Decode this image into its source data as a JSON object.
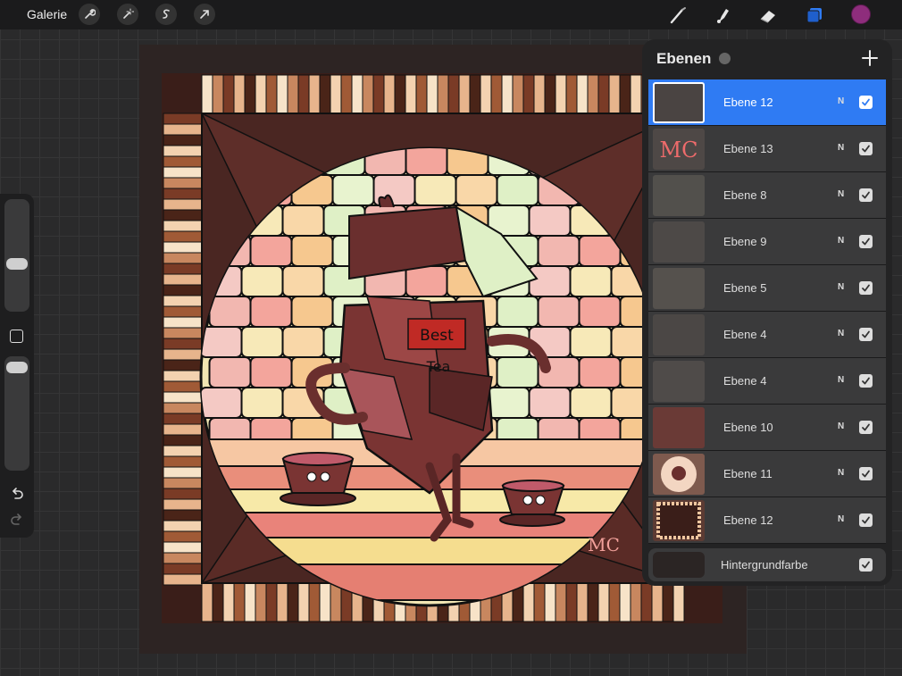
{
  "topbar": {
    "gallery_label": "Galerie",
    "left_tools": [
      "wrench-icon",
      "magic-wand-icon",
      "selection-icon",
      "transform-arrow-icon"
    ],
    "right_tools": [
      "brush-icon",
      "smudge-icon",
      "eraser-icon",
      "layers-icon"
    ],
    "current_color": "#8e2d7c"
  },
  "layers_panel": {
    "title": "Ebenen",
    "add_label": "+",
    "layers": [
      {
        "name": "Ebene 12",
        "mode": "N",
        "visible": true,
        "active": true
      },
      {
        "name": "Ebene 13",
        "mode": "N",
        "visible": true,
        "active": false
      },
      {
        "name": "Ebene 8",
        "mode": "N",
        "visible": true,
        "active": false
      },
      {
        "name": "Ebene 9",
        "mode": "N",
        "visible": true,
        "active": false
      },
      {
        "name": "Ebene 5",
        "mode": "N",
        "visible": true,
        "active": false
      },
      {
        "name": "Ebene 4",
        "mode": "N",
        "visible": true,
        "active": false
      },
      {
        "name": "Ebene 4",
        "mode": "N",
        "visible": true,
        "active": false
      },
      {
        "name": "Ebene 10",
        "mode": "N",
        "visible": true,
        "active": false
      },
      {
        "name": "Ebene 11",
        "mode": "N",
        "visible": true,
        "active": false
      },
      {
        "name": "Ebene 12",
        "mode": "N",
        "visible": true,
        "active": false
      }
    ],
    "background": {
      "name": "Hintergrundfarbe",
      "visible": true,
      "color": "#2b2524"
    }
  },
  "canvas": {
    "artwork": {
      "sign_line1": "Best",
      "sign_line2": "Tea",
      "monogram": "MC"
    }
  },
  "accent_color": "#2f7bf3"
}
